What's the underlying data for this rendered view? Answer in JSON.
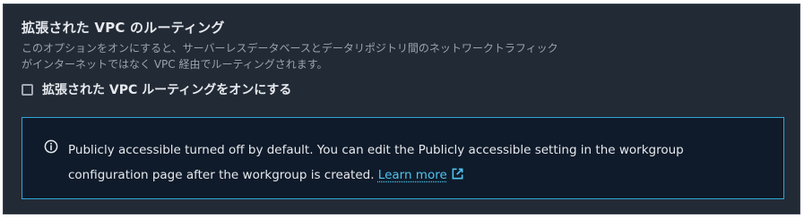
{
  "section": {
    "title": "拡張された VPC のルーティング",
    "description_line1": "このオプションをオンにすると、サーバーレスデータベースとデータリポジトリ間のネットワークトラフィック",
    "description_line2": "がインターネットではなく VPC 経由でルーティングされます。",
    "checkbox_label": "拡張された VPC ルーティングをオンにする",
    "checkbox_checked": false
  },
  "info_alert": {
    "icon": "info-circle-icon",
    "text": "Publicly accessible turned off by default. You can edit the Publicly accessible setting in the workgroup configuration page after the workgroup is created.",
    "link_text": "Learn more",
    "link_icon": "external-link-icon"
  },
  "colors": {
    "panel_background": "#222a35",
    "alert_background": "#0f1b2a",
    "alert_border": "#2fa7d8",
    "link": "#4fc3ef"
  }
}
